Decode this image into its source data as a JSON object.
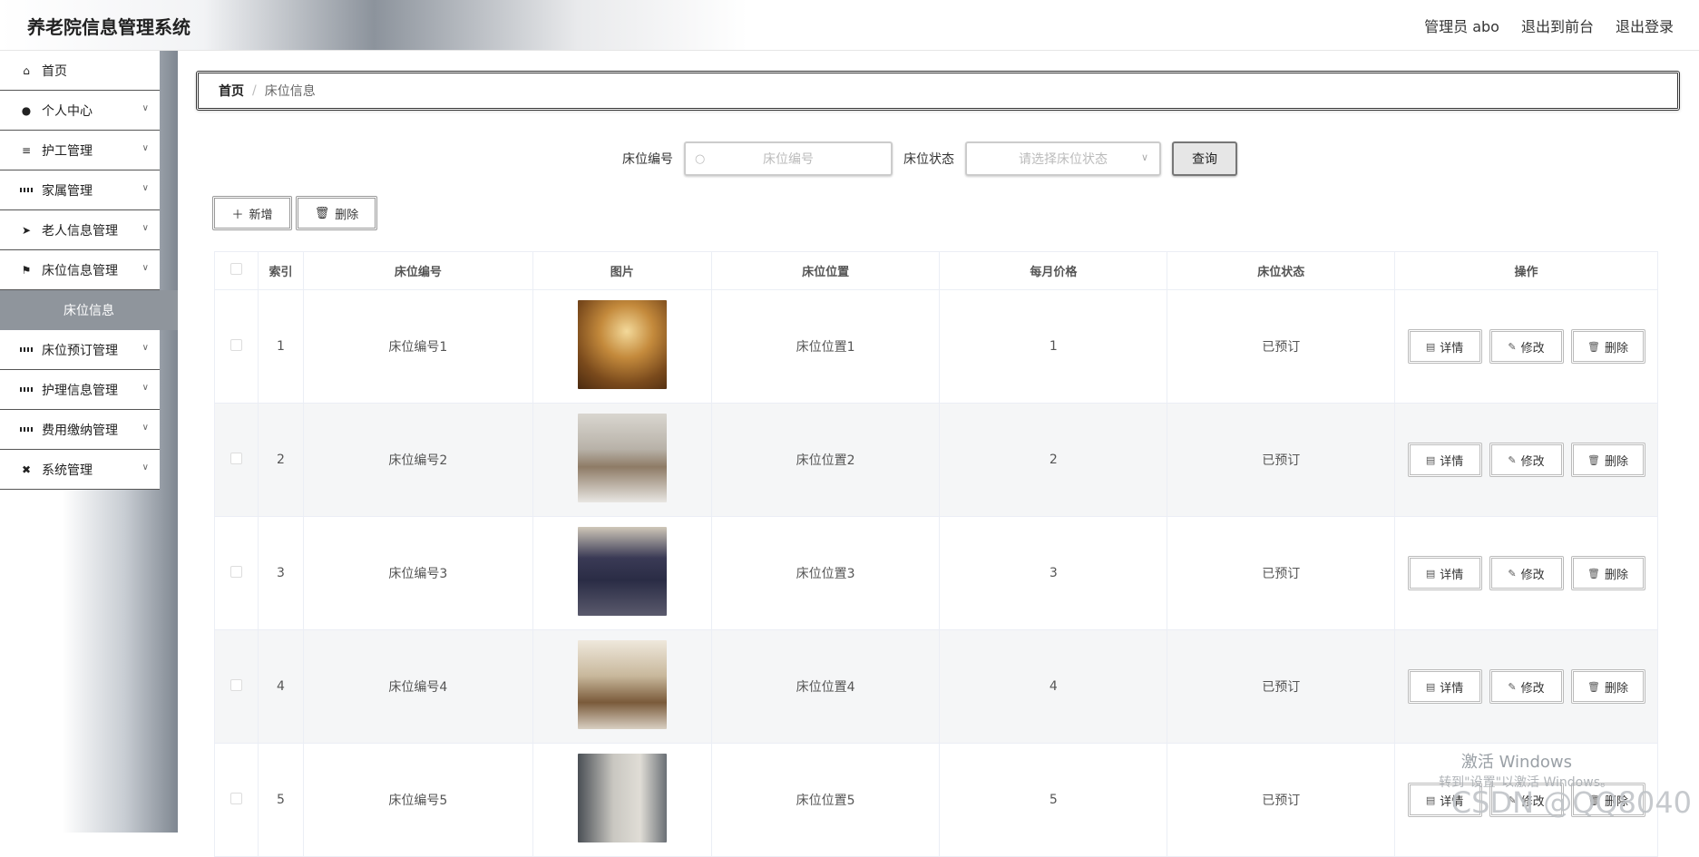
{
  "header": {
    "title": "养老院信息管理系统",
    "user": "管理员 abo",
    "to_front": "退出到前台",
    "logout": "退出登录"
  },
  "sidebar": {
    "items": [
      {
        "label": "首页",
        "icon": "home-icon"
      },
      {
        "label": "个人中心",
        "icon": "user-icon"
      },
      {
        "label": "护工管理",
        "icon": "list-icon"
      },
      {
        "label": "家属管理",
        "icon": "grid-icon"
      },
      {
        "label": "老人信息管理",
        "icon": "send-icon"
      },
      {
        "label": "床位信息管理",
        "icon": "flag-icon"
      },
      {
        "label": "床位信息",
        "icon": ""
      },
      {
        "label": "床位预订管理",
        "icon": "grid-icon"
      },
      {
        "label": "护理信息管理",
        "icon": "grid-icon"
      },
      {
        "label": "费用缴纳管理",
        "icon": "grid-icon"
      },
      {
        "label": "系统管理",
        "icon": "ticket-icon"
      }
    ]
  },
  "breadcrumb": {
    "home": "首页",
    "sep": "/",
    "current": "床位信息"
  },
  "search": {
    "bed_no_label": "床位编号",
    "bed_no_placeholder": "床位编号",
    "status_label": "床位状态",
    "status_placeholder": "请选择床位状态",
    "query": "查询"
  },
  "toolbar": {
    "add": "新增",
    "delete": "删除"
  },
  "table": {
    "headers": [
      "索引",
      "床位编号",
      "图片",
      "床位位置",
      "每月价格",
      "床位状态",
      "操作"
    ],
    "rows": [
      {
        "index": "1",
        "bed_no": "床位编号1",
        "location": "床位位置1",
        "price": "1",
        "status": "已预订"
      },
      {
        "index": "2",
        "bed_no": "床位编号2",
        "location": "床位位置2",
        "price": "2",
        "status": "已预订"
      },
      {
        "index": "3",
        "bed_no": "床位编号3",
        "location": "床位位置3",
        "price": "3",
        "status": "已预订"
      },
      {
        "index": "4",
        "bed_no": "床位编号4",
        "location": "床位位置4",
        "price": "4",
        "status": "已预订"
      },
      {
        "index": "5",
        "bed_no": "床位编号5",
        "location": "床位位置5",
        "price": "5",
        "status": "已预订"
      }
    ],
    "ops": {
      "detail": "详情",
      "edit": "修改",
      "delete": "删除"
    }
  },
  "watermarks": {
    "windows_title": "激活 Windows",
    "windows_sub": "转到\"设置\"以激活 Windows。",
    "csdn": "CSDN @QQ8040"
  }
}
